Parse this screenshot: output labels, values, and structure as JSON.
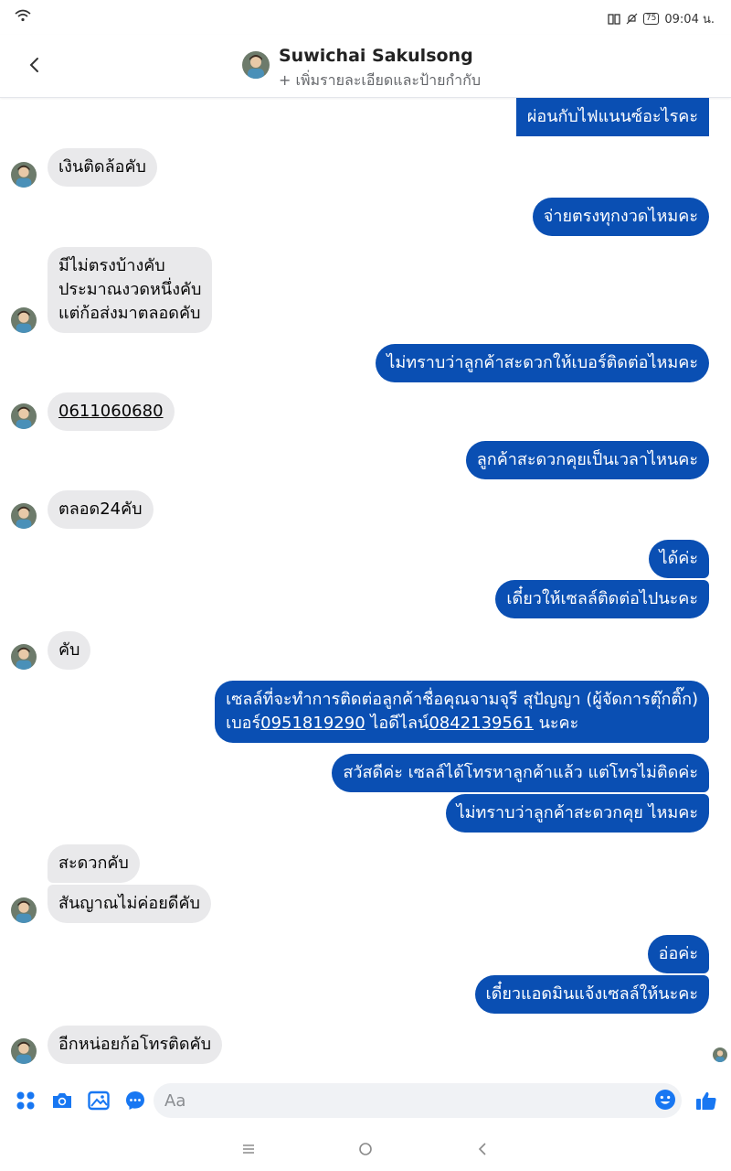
{
  "status": {
    "time": "09:04 น.",
    "battery": "75"
  },
  "header": {
    "name": "Suwichai Sakulsong",
    "subtitle": "+ เพิ่มรายละเอียดและป้ายกำกับ"
  },
  "messages": {
    "m1": "ผ่อนกับไฟแนนซ์อะไรคะ",
    "m2": "เงินติดล้อคับ",
    "m3": "จ่ายตรงทุกงวดไหมคะ",
    "m4": [
      "มีไม่ตรงบ้างคับ",
      "ประมาณงวดหนึ่งคับ",
      "แต่ก้อส่งมาตลอดคับ"
    ],
    "m5": "ไม่ทราบว่าลูกค้าสะดวกให้เบอร์ติดต่อไหมคะ",
    "m6": "0611060680",
    "m7": "ลูกค้าสะดวกคุยเป็นเวลาไหนคะ",
    "m8": "ตลอด24คับ",
    "m9": "ได้ค่ะ",
    "m10": "เดี๋ยวให้เซลล์ติดต่อไปนะคะ",
    "m11": "คับ",
    "m12": {
      "line1": "เซลล์ที่จะทำการติดต่อลูกค้าชื่อคุณจามจุรี สุปัญญา (ผู้จัดการตุ๊กติ๊ก)",
      "line2_a": "เบอร์",
      "line2_phone": "0951819290",
      "line2_b": " ไอดีไลน์",
      "line2_line": "0842139561",
      "line2_c": " นะคะ"
    },
    "m13": "สวัสดีค่ะ เซลล์ได้โทรหาลูกค้าแล้ว แต่โทรไม่ติดค่ะ",
    "m14": "ไม่ทราบว่าลูกค้าสะดวกคุย ไหมคะ",
    "m15": "สะดวกคับ",
    "m16": "สันญาณไม่ค่อยดีคับ",
    "m17": "อ่อค่ะ",
    "m18": "เดี๋ยวแอดมินแจ้งเซลล์ให้นะคะ",
    "m19": "อีกหน่อยก้อโทรติดคับ"
  },
  "composer": {
    "placeholder": "Aa"
  },
  "colors": {
    "accent": "#0a4fb3",
    "incoming": "#e9e9eb",
    "icon": "#1877f2"
  },
  "icons": [
    "wifi-icon",
    "back-icon",
    "apps-icon",
    "camera-icon",
    "gallery-icon",
    "chat-icon",
    "emoji-icon",
    "like-icon",
    "menu-icon",
    "home-icon",
    "nav-back-icon"
  ]
}
